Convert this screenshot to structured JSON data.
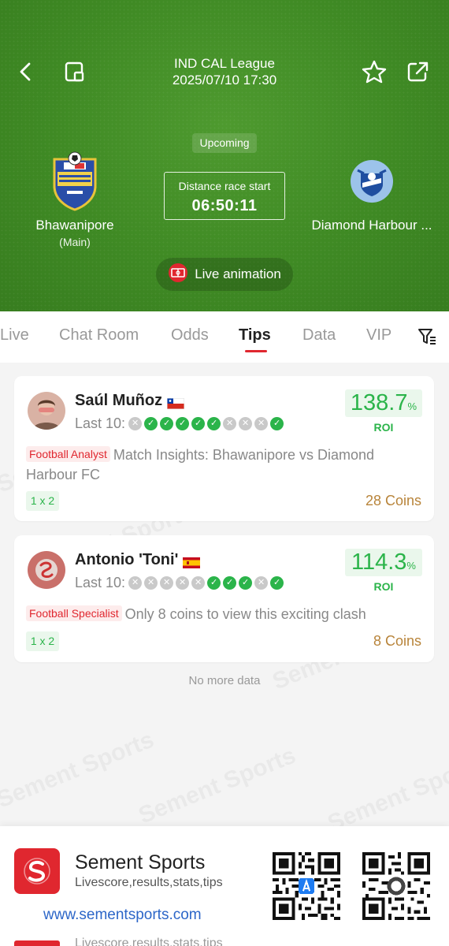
{
  "header": {
    "league": "IND CAL League",
    "datetime": "2025/07/10 17:30",
    "status": "Upcoming",
    "countdown_label": "Distance race start",
    "countdown": "06:50:11",
    "home_team": "Bhawanipore",
    "home_sub": "(Main)",
    "away_team": "Diamond Harbour ...",
    "live_animation": "Live animation"
  },
  "tabs": [
    "Live",
    "Chat Room",
    "Odds",
    "Tips",
    "Data",
    "VIP"
  ],
  "active_tab": "Tips",
  "tips": [
    {
      "name": "Saúl Muñoz",
      "flag": "chile",
      "last10_label": "Last 10:",
      "last10": [
        "L",
        "W",
        "W",
        "W",
        "W",
        "W",
        "L",
        "L",
        "L",
        "W"
      ],
      "roi_value": "138.7",
      "roi_unit": "%",
      "roi_label": "ROI",
      "role": "Football Analyst",
      "title": "Match Insights: Bhawanipore vs Diamond Harbour FC",
      "bet_type": "1 x 2",
      "price": "28 Coins"
    },
    {
      "name": "Antonio 'Toni'",
      "flag": "spain",
      "last10_label": "Last 10:",
      "last10": [
        "L",
        "L",
        "L",
        "L",
        "L",
        "W",
        "W",
        "W",
        "L",
        "W"
      ],
      "roi_value": "114.3",
      "roi_unit": "%",
      "roi_label": "ROI",
      "role": "Football Specialist",
      "title": "Only 8 coins to view this exciting clash",
      "bet_type": "1 x 2",
      "price": "8 Coins"
    }
  ],
  "footer_note": "No more data",
  "watermark": "Sement Sports",
  "banner": {
    "name": "Sement Sports",
    "tagline": "Livescore,results,stats,tips",
    "url": "www.sementsports.com"
  },
  "colors": {
    "accent_red": "#e0272f",
    "win_green": "#2bb44a",
    "coin_brown": "#b8843a",
    "pitch_green": "#3f8a24"
  }
}
